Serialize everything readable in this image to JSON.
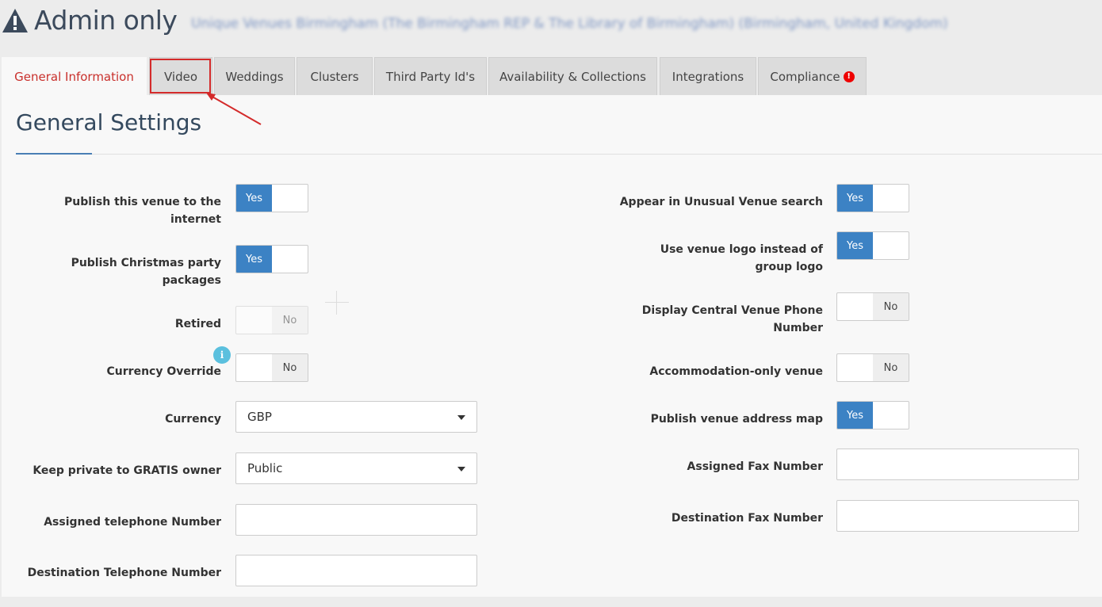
{
  "header": {
    "title": "Admin only",
    "venue_name": "Unique Venues Birmingham (The Birmingham REP & The Library of Birmingham) (Birmingham, United Kingdom)",
    "title_icon": "warning-icon"
  },
  "tabs": [
    {
      "label": "General Information",
      "active": true
    },
    {
      "label": "Video",
      "active": false,
      "highlighted": true
    },
    {
      "label": "Weddings",
      "active": false
    },
    {
      "label": "Clusters",
      "active": false
    },
    {
      "label": "Third Party Id's",
      "active": false
    },
    {
      "label": "Availability & Collections",
      "active": false
    },
    {
      "label": "Integrations",
      "active": false
    },
    {
      "label": "Compliance",
      "active": false,
      "alert_icon": "alert-icon",
      "alert_text": "!"
    }
  ],
  "section": {
    "title": "General Settings"
  },
  "left_fields": {
    "publish_internet": {
      "label": "Publish this venue to the internet",
      "on_label": "Yes",
      "value": "Yes"
    },
    "publish_christmas": {
      "label": "Publish Christmas party packages",
      "on_label": "Yes",
      "value": "Yes"
    },
    "retired": {
      "label": "Retired",
      "off_label": "No",
      "value": "No",
      "disabled": true
    },
    "currency_override": {
      "label": "Currency Override",
      "off_label": "No",
      "value": "No",
      "info_icon": "info-icon",
      "info_text": "i"
    },
    "currency": {
      "label": "Currency",
      "value": "GBP"
    },
    "keep_private": {
      "label": "Keep private to GRATIS owner",
      "value": "Public"
    },
    "assigned_telephone": {
      "label": "Assigned telephone Number",
      "value": ""
    },
    "destination_telephone": {
      "label": "Destination Telephone Number",
      "value": ""
    }
  },
  "right_fields": {
    "unusual_venue": {
      "label": "Appear in Unusual Venue search",
      "on_label": "Yes",
      "value": "Yes"
    },
    "venue_logo": {
      "label": "Use venue logo instead of group logo",
      "on_label": "Yes",
      "value": "Yes"
    },
    "central_phone": {
      "label": "Display Central Venue Phone Number",
      "off_label": "No",
      "value": "No"
    },
    "accommodation_only": {
      "label": "Accommodation-only venue",
      "off_label": "No",
      "value": "No"
    },
    "address_map": {
      "label": "Publish venue address map",
      "on_label": "Yes",
      "value": "Yes"
    },
    "assigned_fax": {
      "label": "Assigned Fax Number",
      "value": ""
    },
    "destination_fax": {
      "label": "Destination Fax Number",
      "value": ""
    }
  },
  "colors": {
    "accent": "#3c82c4",
    "active_tab_text": "#c9302c",
    "annotation": "#d42b2b",
    "info": "#5bc0de"
  }
}
